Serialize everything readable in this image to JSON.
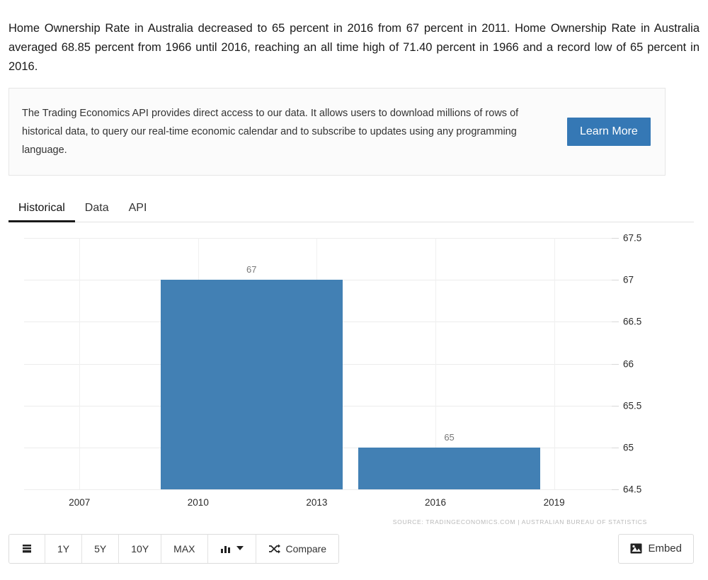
{
  "intro": {
    "text": "Home Ownership Rate in Australia decreased to 65 percent in 2016 from 67 percent in 2011. Home Ownership Rate in Australia averaged 68.85 percent from 1966 until 2016, reaching an all time high of 71.40 percent in 1966 and a record low of 65 percent in 2016."
  },
  "promo": {
    "text": "The Trading Economics API provides direct access to our data. It allows users to download millions of rows of historical data, to query our real-time economic calendar and to subscribe to updates using any programming language.",
    "button_label": "Learn More",
    "button_color": "#3578b5"
  },
  "tabs": [
    {
      "label": "Historical",
      "active": true
    },
    {
      "label": "Data",
      "active": false
    },
    {
      "label": "API",
      "active": false
    }
  ],
  "toolbar": {
    "list_icon": "list-icon",
    "ranges": [
      "1Y",
      "5Y",
      "10Y",
      "MAX"
    ],
    "chart_type_icon": "bar-chart-icon",
    "chart_type_caret": "chevron-down-icon",
    "compare_label": "Compare",
    "compare_icon": "shuffle-icon",
    "embed_label": "Embed",
    "embed_icon": "image-icon"
  },
  "chart_data": {
    "type": "bar",
    "title": "",
    "xlabel": "",
    "ylabel": "",
    "categories": [
      "2011",
      "2016"
    ],
    "values": [
      67,
      65
    ],
    "bar_labels": [
      "67",
      "65"
    ],
    "bar_color": "#4280b4",
    "ylim": [
      64.5,
      67.5
    ],
    "yticks": [
      "67.5",
      "67",
      "66.5",
      "66",
      "65.5",
      "65",
      "64.5"
    ],
    "ytick_values": [
      67.5,
      67,
      66.5,
      66,
      65.5,
      65,
      64.5
    ],
    "xticks": [
      "2007",
      "2010",
      "2013",
      "2016",
      "2019"
    ],
    "xtick_values": [
      2007,
      2010,
      2013,
      2016,
      2019
    ],
    "grid": true,
    "legend": "none",
    "source": "SOURCE: TRADINGECONOMICS.COM  |  AUSTRALIAN BUREAU OF STATISTICS"
  }
}
